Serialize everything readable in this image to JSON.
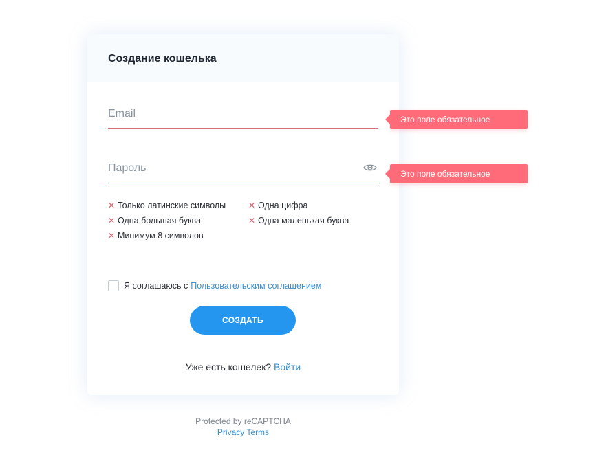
{
  "card": {
    "title": "Создание кошелька"
  },
  "form": {
    "email": {
      "value": "",
      "placeholder": "Email"
    },
    "password": {
      "value": "",
      "placeholder": "Пароль"
    }
  },
  "errors": {
    "email": "Это поле обязательное",
    "password": "Это поле обязательное"
  },
  "password_rules": [
    {
      "label": "Только латинские символы",
      "met": false
    },
    {
      "label": "Одна цифра",
      "met": false
    },
    {
      "label": "Одна большая буква",
      "met": false
    },
    {
      "label": "Одна маленькая буква",
      "met": false
    },
    {
      "label": "Минимум 8 символов",
      "met": false
    }
  ],
  "rule_mark": "✕",
  "agreement": {
    "checked": false,
    "text": "Я соглашаюсь с",
    "link": "Пользовательским соглашением"
  },
  "submit_label": "СОЗДАТЬ",
  "login": {
    "text": "Уже есть кошелек?",
    "link": "Войти"
  },
  "recaptcha": {
    "text": "Protected by reCAPTCHA",
    "privacy": "Privacy",
    "terms": "Terms"
  },
  "colors": {
    "accent": "#2496f0",
    "link": "#3a8fd0",
    "error": "#ff6b78",
    "error_line": "#d76b78"
  },
  "icons": {
    "password_toggle": "eye-icon",
    "rule_status": "close-x-icon"
  }
}
